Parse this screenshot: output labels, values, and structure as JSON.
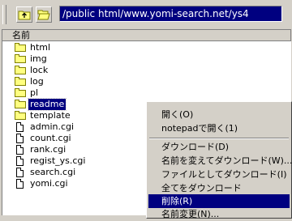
{
  "toolbar": {
    "up_icon": "folder-up-icon",
    "open_icon": "open-folder-icon",
    "path": "/public html/www.yomi-search.net/ys4"
  },
  "list": {
    "column_header": "名前",
    "items": [
      {
        "name": "html",
        "type": "folder"
      },
      {
        "name": "img",
        "type": "folder"
      },
      {
        "name": "lock",
        "type": "folder"
      },
      {
        "name": "log",
        "type": "folder"
      },
      {
        "name": "pl",
        "type": "folder"
      },
      {
        "name": "readme",
        "type": "folder",
        "selected": true
      },
      {
        "name": "template",
        "type": "folder"
      },
      {
        "name": "admin.cgi",
        "type": "file"
      },
      {
        "name": "count.cgi",
        "type": "file"
      },
      {
        "name": "rank.cgi",
        "type": "file"
      },
      {
        "name": "regist_ys.cgi",
        "type": "file"
      },
      {
        "name": "search.cgi",
        "type": "file"
      },
      {
        "name": "yomi.cgi",
        "type": "file"
      }
    ]
  },
  "context_menu": {
    "items": [
      {
        "label": "開く(O)"
      },
      {
        "label": "notepadで開く(1)"
      },
      {
        "label": "ダウンロード(D)"
      },
      {
        "label": "名前を変えてダウンロード(W)..."
      },
      {
        "label": "ファイルとしてダウンロード(I)"
      },
      {
        "label": "全てをダウンロード"
      },
      {
        "label": "削除(R)",
        "highlighted": true
      },
      {
        "label": "名前変更(N)..."
      }
    ]
  },
  "colors": {
    "selection": "#000080",
    "face": "#d4d0c8"
  }
}
